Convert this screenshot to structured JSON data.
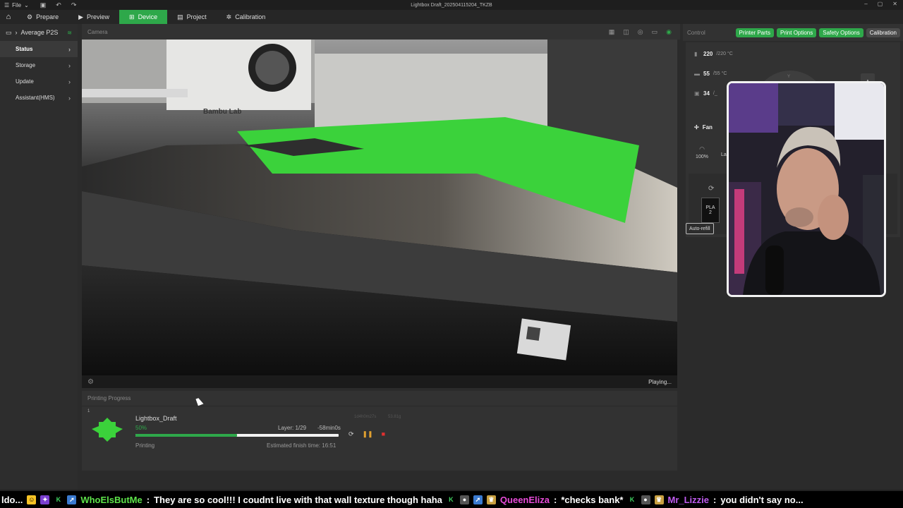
{
  "titlebar": {
    "menu": "File",
    "title": "Lightbox Draft_20250411520​4_TKZB"
  },
  "tabs": [
    {
      "label": "Prepare"
    },
    {
      "label": "Preview"
    },
    {
      "label": "Device"
    },
    {
      "label": "Project"
    },
    {
      "label": "Calibration"
    }
  ],
  "sidebar": {
    "printer": "Average P2S",
    "items": [
      {
        "label": "Status"
      },
      {
        "label": "Storage"
      },
      {
        "label": "Update"
      },
      {
        "label": "Assistant(HMS)"
      }
    ]
  },
  "camera": {
    "header": "Camera",
    "status": "Playing...",
    "brand_text": "Bambu Lab"
  },
  "progress": {
    "header": "Printing Progress",
    "plate": "1",
    "job_name": "Lightbox_Draft",
    "percent_text": "50%",
    "percent": 0.5,
    "layer": "Layer: 1/29",
    "remaining": "-58min0s",
    "faint_a": "1d4h0m27s",
    "faint_b": "53.81g",
    "state": "Printing",
    "finish": "Estimated finish time: 16:51"
  },
  "control": {
    "header": "Control",
    "buttons": [
      {
        "label": "Printer Parts"
      },
      {
        "label": "Print Options"
      },
      {
        "label": "Safety Options"
      },
      {
        "label": "Calibration"
      }
    ],
    "nozzle_temp": "220",
    "nozzle_target": "/220 °C",
    "bed_temp": "55",
    "bed_target": "/55 °C",
    "chamber_temp": "34",
    "chamber_target": "/_",
    "fan_label": "Fan",
    "fan_percent": "100%",
    "lamp_label": "La",
    "axis_label": "Y",
    "ams_slot": "PLA",
    "ams_slot_num": "2",
    "auto_refill": "Auto-refill"
  },
  "ticker": {
    "lead": "ldo...",
    "user1": "WhoElsButMe",
    "msg1": "They are so cool!!! I coudnt live with that wall texture though haha",
    "user2": "QueenEliza",
    "msg2": "*checks bank*",
    "user3": "Mr_Lizzie",
    "msg3": "you didn't say no..."
  },
  "colors": {
    "accent": "#2ea84a",
    "pause": "#e0a030",
    "stop": "#e03030"
  }
}
